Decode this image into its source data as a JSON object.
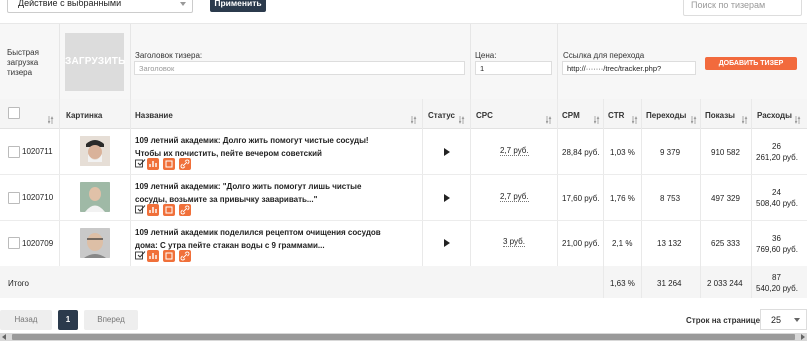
{
  "toolbar": {
    "bulk_action": "Действие с выбранными",
    "apply_label": "Применить",
    "search_placeholder": "Поиск по тизерам"
  },
  "upload": {
    "label": "Быстрая загрузка тизера",
    "image_label": "ЗАГРУЗИТЬ",
    "title_label": "Заголовок тизера:",
    "title_placeholder": "Заголовок",
    "price_label": "Цена:",
    "price_value": "1",
    "link_label": "Ссылка для перехода",
    "link_value": "http://·······/trec/tracker.php?",
    "add_label": "ДОБАВИТЬ ТИЗЕР"
  },
  "table": {
    "headers": {
      "image": "Картинка",
      "name": "Название",
      "status": "Статус",
      "cpc": "CPC",
      "cpm": "CPM",
      "ctr": "CTR",
      "clicks": "Переходы",
      "shows": "Показы",
      "spend": "Расходы"
    },
    "rows": [
      {
        "id": "1020711",
        "title": "109 летний академик: Долго жить помогут чистые сосуды! Чтобы их почистить, пейте вечером советский",
        "cpc": "2,7 руб.",
        "cpm": "28,84 руб.",
        "ctr": "1,03 %",
        "clicks": "9 379",
        "shows": "910 582",
        "spend_1": "26",
        "spend_2": "261,20 руб."
      },
      {
        "id": "1020710",
        "title": "109 летний академик: \"Долго жить помогут лишь чистые сосуды, возьмите за привычку заваривать...\"",
        "cpc": "2,7 руб.",
        "cpm": "17,60 руб.",
        "ctr": "1,76 %",
        "clicks": "8 753",
        "shows": "497 329",
        "spend_1": "24",
        "spend_2": "508,40 руб."
      },
      {
        "id": "1020709",
        "title": "109 летний академик поделился рецептом очищения сосудов дома: С утра пейте стакан воды с 9 граммами...",
        "cpc": "3 руб.",
        "cpm": "21,00 руб.",
        "ctr": "2,1 %",
        "clicks": "13 132",
        "shows": "625 333",
        "spend_1": "36",
        "spend_2": "769,60 руб."
      }
    ],
    "total": {
      "label": "Итого",
      "ctr": "1,63 %",
      "clicks": "31 264",
      "shows": "2 033 244",
      "spend_1": "87",
      "spend_2": "540,20 руб."
    }
  },
  "pagination": {
    "prev": "Назад",
    "page": "1",
    "next": "Вперед",
    "per_page_label": "Строк на странице",
    "per_page_value": "25"
  },
  "colors": {
    "accent": "#f26a3d",
    "dark": "#2b3a4c"
  }
}
